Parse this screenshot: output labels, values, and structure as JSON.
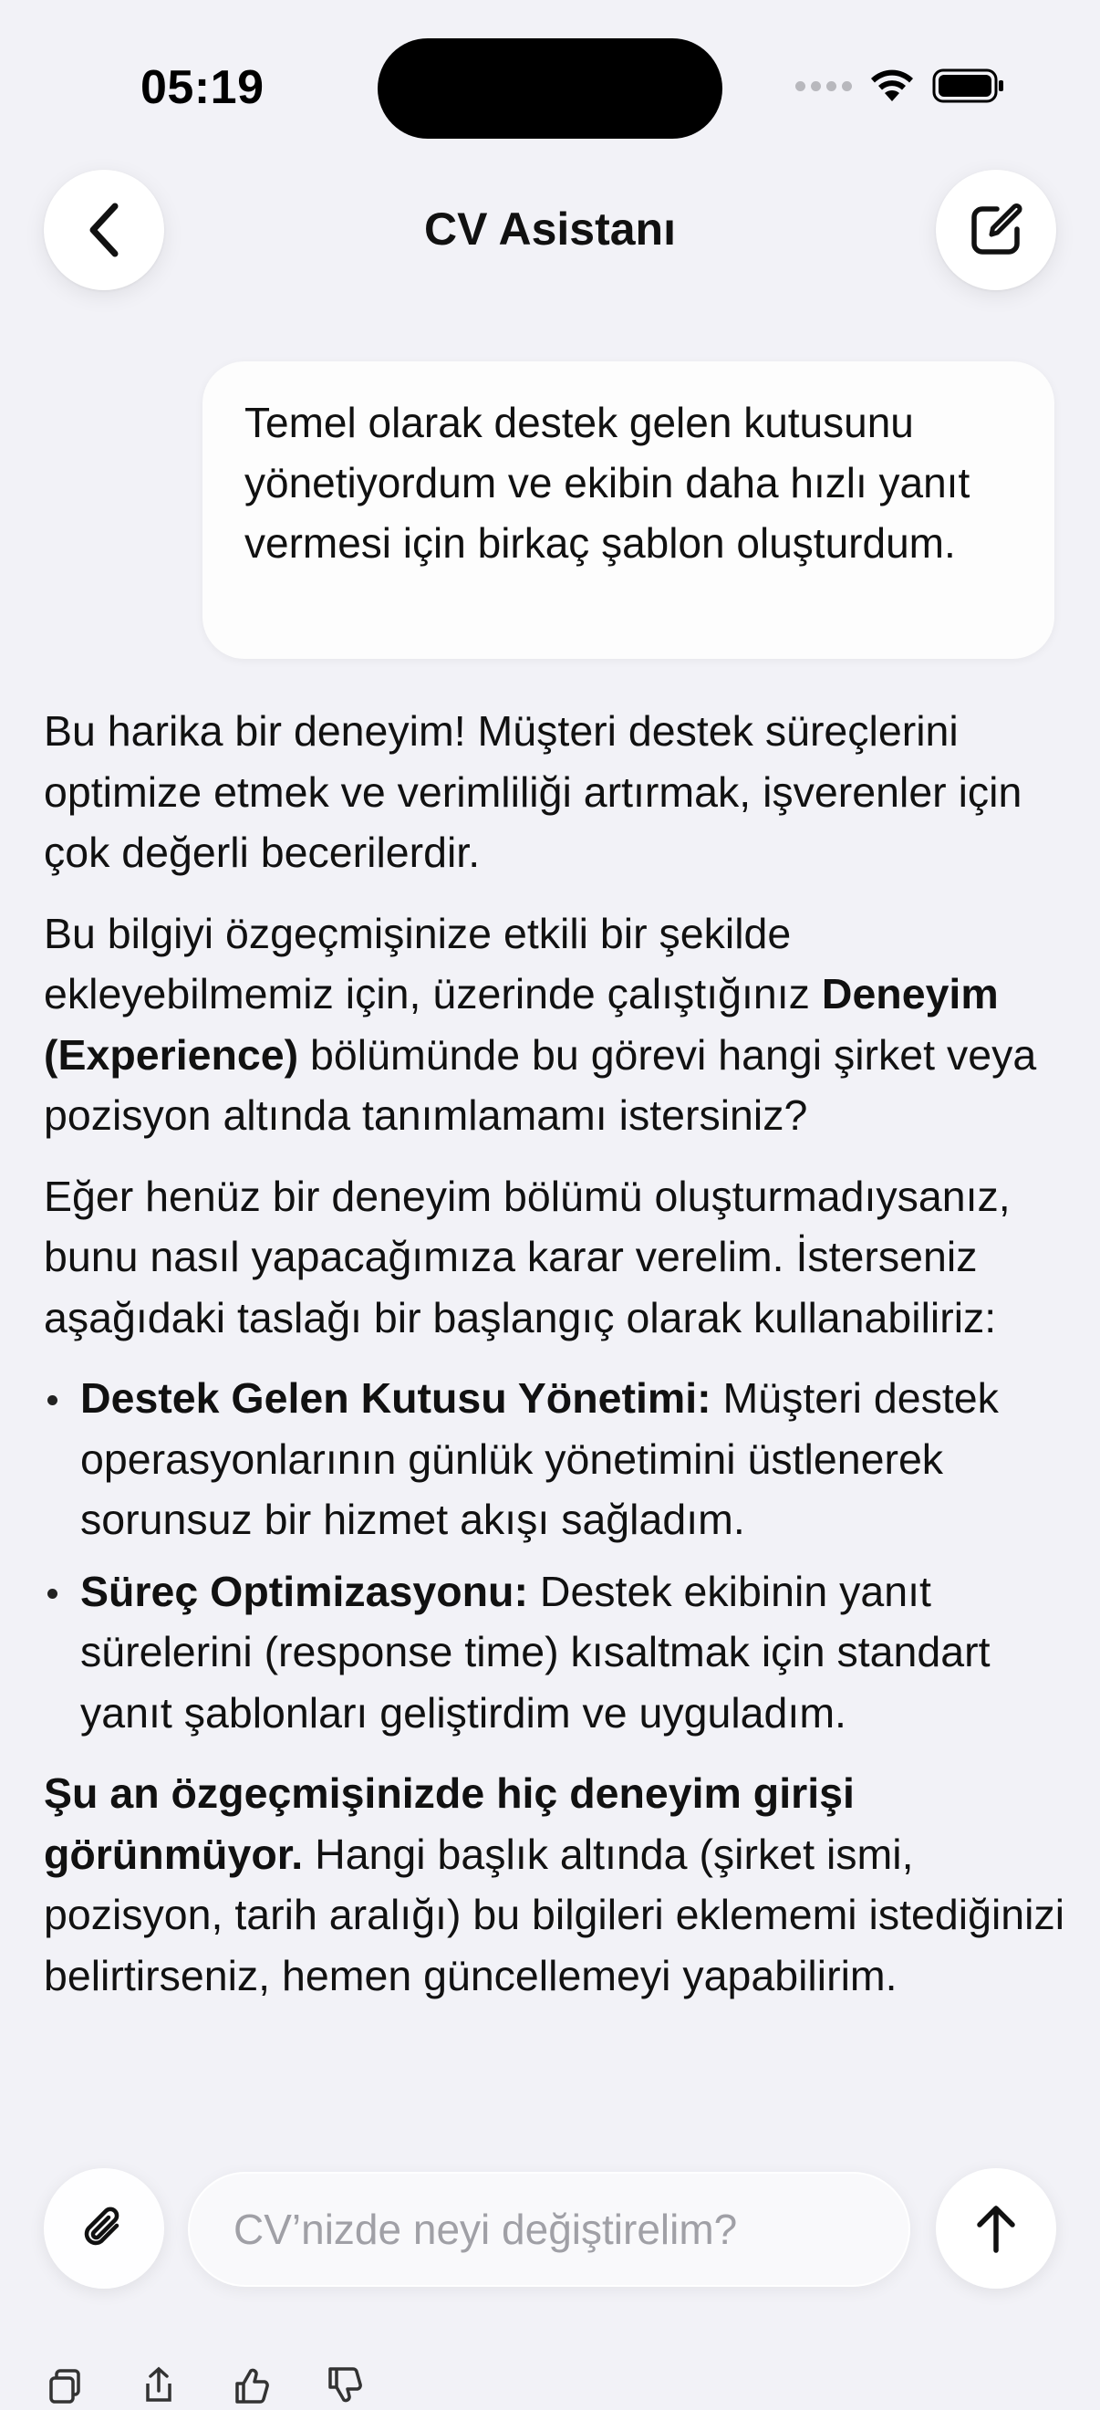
{
  "status_bar": {
    "time": "05:19"
  },
  "nav": {
    "title": "CV Asistanı",
    "back_icon": "chevron-left-icon",
    "compose_icon": "compose-icon"
  },
  "user_message": {
    "text": "Temel olarak destek gelen kutusunu yönetiyordum ve ekibin daha hızlı yanıt vermesi için birkaç şablon oluşturdum."
  },
  "assistant_message": {
    "p1": "Bu harika bir deneyim! Müşteri destek süreçlerini optimize etmek ve verimliliği artırmak, işverenler için çok değerli becerilerdir.",
    "p2_a": "Bu bilgiyi özgeçmişinize etkili bir şekilde ekleyebilmemiz için, üzerinde çalıştığınız ",
    "p2_bold": "Deneyim (Experience)",
    "p2_b": " bölümünde bu görevi hangi şirket veya pozisyon altında tanımlamamı istersiniz?",
    "p3": "Eğer henüz bir deneyim bölümü oluşturmadıysanız, bunu nasıl yapacağımıza karar verelim. İsterseniz aşağıdaki taslağı bir başlangıç olarak kullanabiliriz:",
    "bullets": [
      {
        "title": "Destek Gelen Kutusu Yönetimi:",
        "text": " Müşteri destek operasyonlarının günlük yönetimini üstlenerek sorunsuz bir hizmet akışı sağladım."
      },
      {
        "title": "Süreç Optimizasyonu:",
        "text": " Destek ekibinin yanıt sürelerini (response time) kısaltmak için standart yanıt şablonları geliştirdim ve uyguladım."
      }
    ],
    "p4_bold": "Şu an özgeçmişinizde hiç deneyim girişi görünmüyor.",
    "p4_text": " Hangi başlık altında (şirket ismi, pozisyon, tarih aralığı) bu bilgileri eklememi istediğinizi belirtirseniz, hemen güncellemeyi yapabilirim."
  },
  "input_bar": {
    "placeholder": "CV’nizde neyi değiştirelim?",
    "value": ""
  },
  "message_actions": [
    "copy-icon",
    "share-icon",
    "thumbs-up-icon",
    "thumbs-down-icon"
  ]
}
